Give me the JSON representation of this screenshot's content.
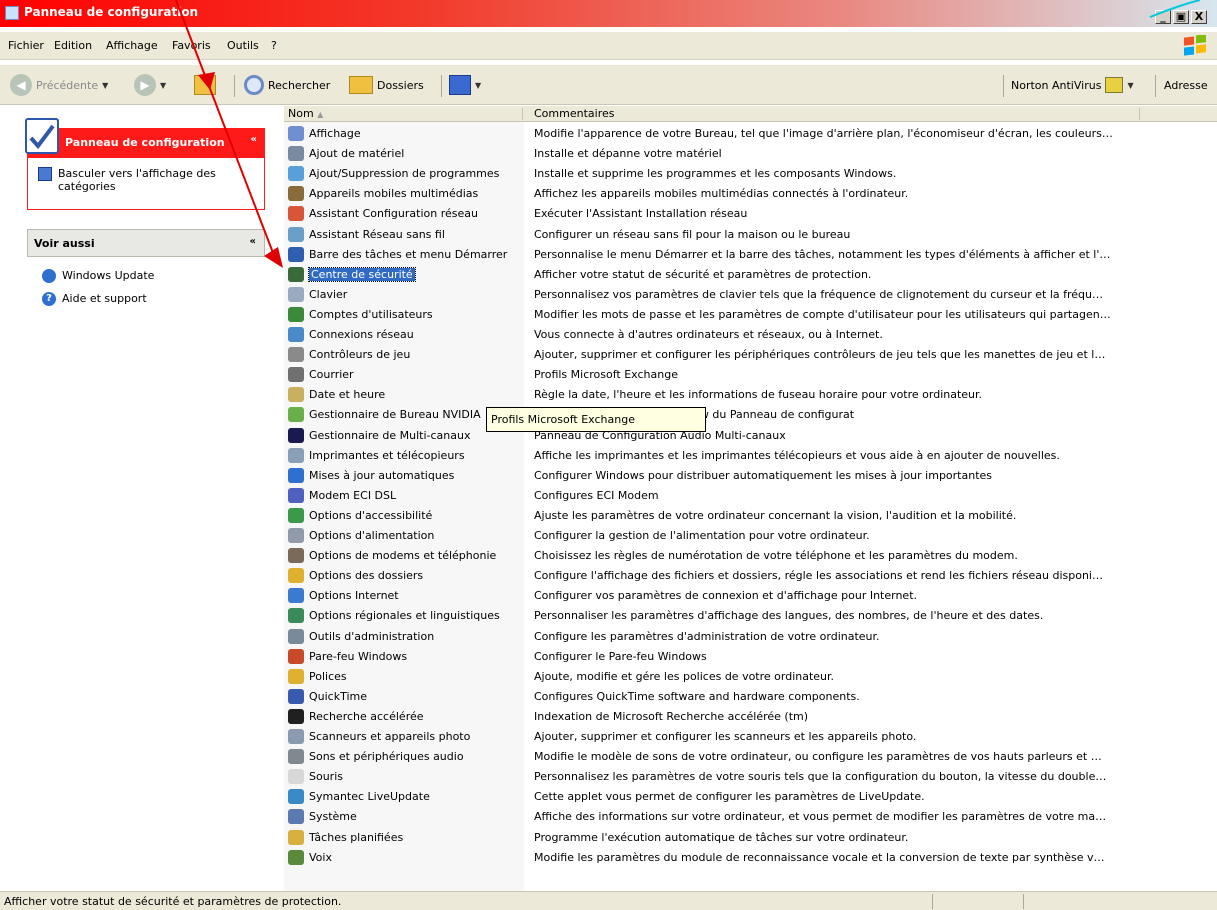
{
  "window": {
    "title": "Panneau de configuration"
  },
  "window_controls": {
    "minimize": "_",
    "maximize": "à",
    "close": "X"
  },
  "menu": [
    "Fichier",
    "Edition",
    "Affichage",
    "Favoris",
    "Outils",
    "?"
  ],
  "toolbar": {
    "back_label": "Précédente",
    "search_label": "Rechercher",
    "folders_label": "Dossiers",
    "norton_label": "Norton AntiVirus",
    "address_label": "Adresse"
  },
  "left_panel": {
    "panel_title": "Panneau de configuration",
    "switch_view_label": "Basculer vers l'affichage des catégories",
    "see_also_title": "Voir aussi",
    "see_also_items": [
      "Windows Update",
      "Aide et support"
    ]
  },
  "list": {
    "columns": {
      "name": "Nom",
      "comments": "Commentaires"
    },
    "selected_index": 7,
    "items": [
      {
        "name": "Affichage",
        "comment": "Modifie l'apparence de votre Bureau, tel que l'image d'arrière plan, l'économiseur d'écran, les couleurs…",
        "icon": "display-icon",
        "color": "#6f8fd0"
      },
      {
        "name": "Ajout de matériel",
        "comment": "Installe et dépanne votre matériel",
        "icon": "hardware-icon",
        "color": "#7a8aa0"
      },
      {
        "name": "Ajout/Suppression de programmes",
        "comment": "Installe et supprime les programmes et les composants Windows.",
        "icon": "programs-icon",
        "color": "#5aa0d8"
      },
      {
        "name": "Appareils mobiles multimédias",
        "comment": "Affichez les appareils mobiles multimédias connectés à l'ordinateur.",
        "icon": "mobile-devices-icon",
        "color": "#8a6b3a"
      },
      {
        "name": "Assistant Configuration réseau",
        "comment": "Exécuter l'Assistant Installation réseau",
        "icon": "network-setup-icon",
        "color": "#d8553a"
      },
      {
        "name": "Assistant Réseau sans fil",
        "comment": "Configurer un réseau sans fil pour la maison ou le bureau",
        "icon": "wireless-icon",
        "color": "#6aa0c8"
      },
      {
        "name": "Barre des tâches et menu Démarrer",
        "comment": "Personnalise le menu Démarrer et la barre des tâches, notamment les types d'éléments à afficher et l'…",
        "icon": "taskbar-icon",
        "color": "#2f5fb0"
      },
      {
        "name": "Centre de sécurité",
        "comment": "Afficher votre statut de sécurité et paramètres de protection.",
        "icon": "shield-icon",
        "color": "#3a6a3a"
      },
      {
        "name": "Clavier",
        "comment": "Personnalisez vos paramètres de clavier tels que la fréquence de clignotement du curseur et la fréqu…",
        "icon": "keyboard-icon",
        "color": "#9aa8c0"
      },
      {
        "name": "Comptes d'utilisateurs",
        "comment": "Modifier les mots de passe et les paramètres de compte d'utilisateur pour les utilisateurs qui partagen…",
        "icon": "users-icon",
        "color": "#3a8a3a"
      },
      {
        "name": "Connexions réseau",
        "comment": "Vous connecte à d'autres ordinateurs et réseaux, ou à Internet.",
        "icon": "network-connections-icon",
        "color": "#4a8ac8"
      },
      {
        "name": "Contrôleurs de jeu",
        "comment": "Ajouter, supprimer et configurer les périphériques contrôleurs de jeu tels que les manettes de jeu et l…",
        "icon": "gamepad-icon",
        "color": "#8a8a8a"
      },
      {
        "name": "Courrier",
        "comment": "Profils Microsoft Exchange",
        "icon": "mail-icon",
        "color": "#707070"
      },
      {
        "name": "Date et heure",
        "comment": "Règle la date, l'heure et les informations de fuseau horaire pour votre ordinateur.",
        "icon": "clock-icon",
        "color": "#c8b060"
      },
      {
        "name": "Gestionnaire de Bureau NVIDIA",
        "comment": "Affiche l'interface NVIDIA nView du Panneau de configurat",
        "icon": "nvidia-icon",
        "color": "#6ab04a"
      },
      {
        "name": "Gestionnaire de Multi-canaux",
        "comment": "Panneau de Configuration Audio Multi-canaux",
        "icon": "audio-channels-icon",
        "color": "#1a1a50"
      },
      {
        "name": "Imprimantes et télécopieurs",
        "comment": "Affiche les imprimantes et les imprimantes télécopieurs et vous aide à en ajouter de nouvelles.",
        "icon": "printer-icon",
        "color": "#8aa0b8"
      },
      {
        "name": "Mises à jour automatiques",
        "comment": "Configurer Windows pour distribuer automatiquement les mises à jour importantes",
        "icon": "windows-update-icon",
        "color": "#2f6fd0"
      },
      {
        "name": "Modem ECI DSL",
        "comment": "Configures ECI Modem",
        "icon": "modem-icon",
        "color": "#5060c0"
      },
      {
        "name": "Options d'accessibilité",
        "comment": "Ajuste les paramètres de votre ordinateur concernant la vision, l'audition et la mobilité.",
        "icon": "accessibility-icon",
        "color": "#3a9a4a"
      },
      {
        "name": "Options d'alimentation",
        "comment": "Configurer la gestion de l'alimentation pour votre ordinateur.",
        "icon": "power-icon",
        "color": "#909aa8"
      },
      {
        "name": "Options de modems et téléphonie",
        "comment": "Choisissez les règles de numérotation de votre téléphone et les paramètres du modem.",
        "icon": "phone-icon",
        "color": "#7a6a5a"
      },
      {
        "name": "Options des dossiers",
        "comment": "Configure l'affichage des fichiers et dossiers, régle les associations et rend les fichiers réseau disponi…",
        "icon": "folder-options-icon",
        "color": "#e0b030"
      },
      {
        "name": "Options Internet",
        "comment": "Configurer vos paramètres de connexion et d'affichage pour Internet.",
        "icon": "internet-icon",
        "color": "#3a7ad0"
      },
      {
        "name": "Options régionales et linguistiques",
        "comment": "Personnaliser les paramètres d'affichage des langues, des nombres, de l'heure et des dates.",
        "icon": "globe-icon",
        "color": "#3a8a5a"
      },
      {
        "name": "Outils d'administration",
        "comment": "Configure les paramètres d'administration de votre ordinateur.",
        "icon": "admin-tools-icon",
        "color": "#7a8a9a"
      },
      {
        "name": "Pare-feu Windows",
        "comment": "Configurer le Pare-feu Windows",
        "icon": "firewall-icon",
        "color": "#c84a2a"
      },
      {
        "name": "Polices",
        "comment": "Ajoute, modifie et gére les polices de votre ordinateur.",
        "icon": "fonts-icon",
        "color": "#e0b030"
      },
      {
        "name": "QuickTime",
        "comment": "Configures QuickTime software and hardware components.",
        "icon": "quicktime-icon",
        "color": "#3a5ab0"
      },
      {
        "name": "Recherche accélérée",
        "comment": "Indexation de Microsoft Recherche accélérée (tm)",
        "icon": "binoculars-icon",
        "color": "#202020"
      },
      {
        "name": "Scanneurs et appareils photo",
        "comment": "Ajouter, supprimer et configurer les scanneurs et les appareils photo.",
        "icon": "scanner-icon",
        "color": "#8a9ab0"
      },
      {
        "name": "Sons et périphériques audio",
        "comment": "Modifie le modèle de sons de votre ordinateur, ou configure les paramètres de vos hauts parleurs et …",
        "icon": "speaker-icon",
        "color": "#808890"
      },
      {
        "name": "Souris",
        "comment": "Personnalisez les paramètres de votre souris tels que la configuration du bouton, la vitesse du double…",
        "icon": "mouse-icon",
        "color": "#d8d8d8"
      },
      {
        "name": "Symantec LiveUpdate",
        "comment": "Cette applet vous permet de configurer les paramètres de LiveUpdate.",
        "icon": "liveupdate-icon",
        "color": "#3a8ac8"
      },
      {
        "name": "Système",
        "comment": "Affiche des informations sur votre ordinateur, et vous permet de modifier les paramètres de votre ma…",
        "icon": "system-icon",
        "color": "#5a7ab0"
      },
      {
        "name": "Tâches planifiées",
        "comment": "Programme l'exécution automatique de tâches sur votre ordinateur.",
        "icon": "scheduled-tasks-icon",
        "color": "#d8b040"
      },
      {
        "name": "Voix",
        "comment": "Modifie les paramètres du module de reconnaissance vocale et la conversion de texte par synthèse v…",
        "icon": "voice-icon",
        "color": "#5a8a3a"
      }
    ]
  },
  "tooltip": {
    "text": "Profils Microsoft Exchange"
  },
  "status": {
    "text": "Afficher votre statut de sécurité et paramètres de protection."
  },
  "colors": {
    "title_red": "#ff0000",
    "panel_red": "#ff1a1a",
    "selection_blue": "#316ac5",
    "annotation_red": "#e00000"
  }
}
